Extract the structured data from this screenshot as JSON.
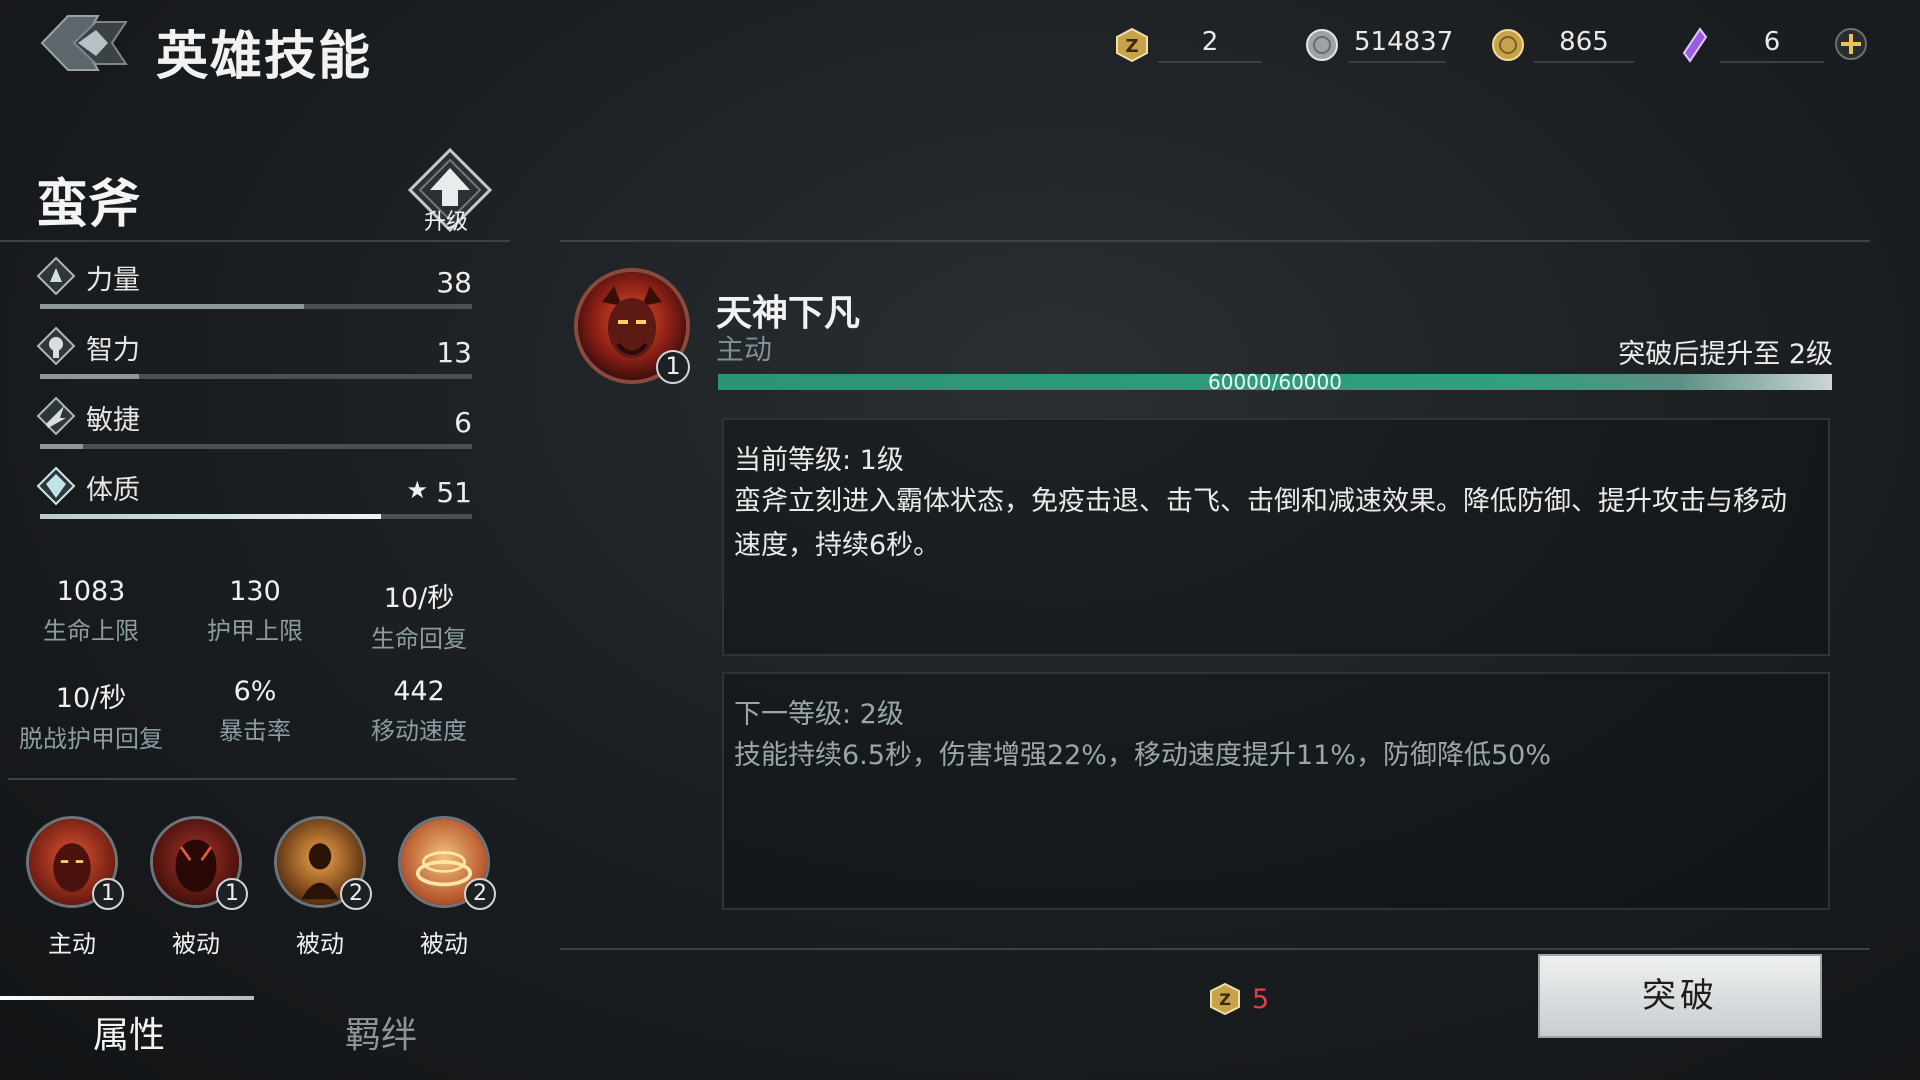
{
  "header": {
    "title": "英雄技能",
    "currencies": [
      {
        "icon": "z-token-icon",
        "value": "2"
      },
      {
        "icon": "silver-coin-icon",
        "value": "514837"
      },
      {
        "icon": "gold-coin-icon",
        "value": "865"
      },
      {
        "icon": "purple-crystal-icon",
        "value": "6"
      }
    ]
  },
  "hero": {
    "name": "蛮斧",
    "upgrade_label": "升级",
    "stats": [
      {
        "icon": "strength-icon",
        "name": "力量",
        "value": "38",
        "fill": 0.61
      },
      {
        "icon": "intelligence-icon",
        "name": "智力",
        "value": "13",
        "fill": 0.23
      },
      {
        "icon": "agility-icon",
        "name": "敏捷",
        "value": "6",
        "fill": 0.1
      },
      {
        "icon": "constitution-icon",
        "name": "体质",
        "value": "51",
        "star": "★",
        "fill": 0.79
      }
    ],
    "attributes": [
      {
        "value": "1083",
        "label": "生命上限"
      },
      {
        "value": "130",
        "label": "护甲上限"
      },
      {
        "value": "10/秒",
        "label": "生命回复"
      },
      {
        "value": "10/秒",
        "label": "脱战护甲回复"
      },
      {
        "value": "6%",
        "label": "暴击率"
      },
      {
        "value": "442",
        "label": "移动速度"
      }
    ],
    "skills": [
      {
        "level": "1",
        "type": "主动"
      },
      {
        "level": "1",
        "type": "被动"
      },
      {
        "level": "2",
        "type": "被动"
      },
      {
        "level": "2",
        "type": "被动"
      }
    ],
    "tabs": [
      "属性",
      "羁绊"
    ]
  },
  "skill_detail": {
    "name": "天神下凡",
    "type": "主动",
    "level_badge": "1",
    "promote_text": "突破后提升至 2级",
    "exp_text": "60000/60000",
    "exp_fill": 1.0,
    "current_header": "当前等级: 1级",
    "current_desc": "蛮斧立刻进入霸体状态，免疫击退、击飞、击倒和减速效果。降低防御、提升攻击与移动速度，持续6秒。",
    "next_header": "下一等级: 2级",
    "next_desc": "技能持续6.5秒，伤害增强22%，移动速度提升11%，防御降低50%",
    "cost": "5",
    "breakthrough_label": "突破"
  },
  "colors": {
    "exp_bar": "#2fa07f",
    "cost_text": "#e23d4c",
    "accent_red": "#c0392b"
  }
}
